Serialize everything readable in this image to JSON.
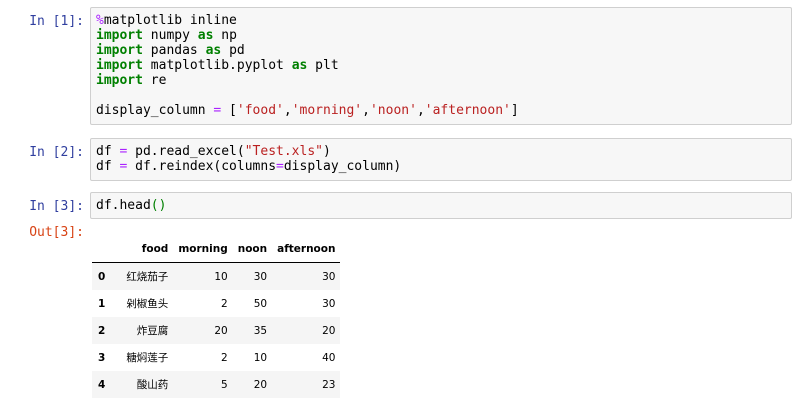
{
  "cells": {
    "c1": {
      "prompt": "In [1]:",
      "l1_magic": "%",
      "l1_rest": "matplotlib inline",
      "l2_kw": "import",
      "l2_mid": " numpy ",
      "l2_as": "as",
      "l2_end": " np",
      "l3_kw": "import",
      "l3_mid": " pandas ",
      "l3_as": "as",
      "l3_end": " pd",
      "l4_kw": "import",
      "l4_mid": " matplotlib.pyplot ",
      "l4_as": "as",
      "l4_end": " plt",
      "l5_kw": "import",
      "l5_end": " re",
      "l7_var": "display_column ",
      "l7_eq": "=",
      "l7_open": " [",
      "l7_s1": "'food'",
      "l7_s2": "'morning'",
      "l7_s3": "'noon'",
      "l7_s4": "'afternoon'",
      "l7_close": "]",
      "comma": ","
    },
    "c2": {
      "prompt": "In [2]:",
      "l1_var": "df ",
      "l1_eq": "=",
      "l1_call": " pd.read_excel(",
      "l1_str": "\"Test.xls\"",
      "l1_close": ")",
      "l2_var": "df ",
      "l2_eq": "=",
      "l2_call": " df.reindex(columns",
      "l2_eq2": "=",
      "l2_arg": "display_column)"
    },
    "c3": {
      "prompt": "In [3]:",
      "code": "df.head",
      "parens": "()"
    },
    "out3": {
      "prompt": "Out[3]:"
    }
  },
  "table": {
    "columns": [
      "",
      "food",
      "morning",
      "noon",
      "afternoon"
    ],
    "rows": [
      {
        "index": "0",
        "food": "红烧茄子",
        "morning": "10",
        "noon": "30",
        "afternoon": "30"
      },
      {
        "index": "1",
        "food": "剁椒鱼头",
        "morning": "2",
        "noon": "50",
        "afternoon": "30"
      },
      {
        "index": "2",
        "food": "炸豆腐",
        "morning": "20",
        "noon": "35",
        "afternoon": "20"
      },
      {
        "index": "3",
        "food": "糖焖莲子",
        "morning": "2",
        "noon": "10",
        "afternoon": "40"
      },
      {
        "index": "4",
        "food": "酸山药",
        "morning": "5",
        "noon": "20",
        "afternoon": "23"
      }
    ]
  }
}
